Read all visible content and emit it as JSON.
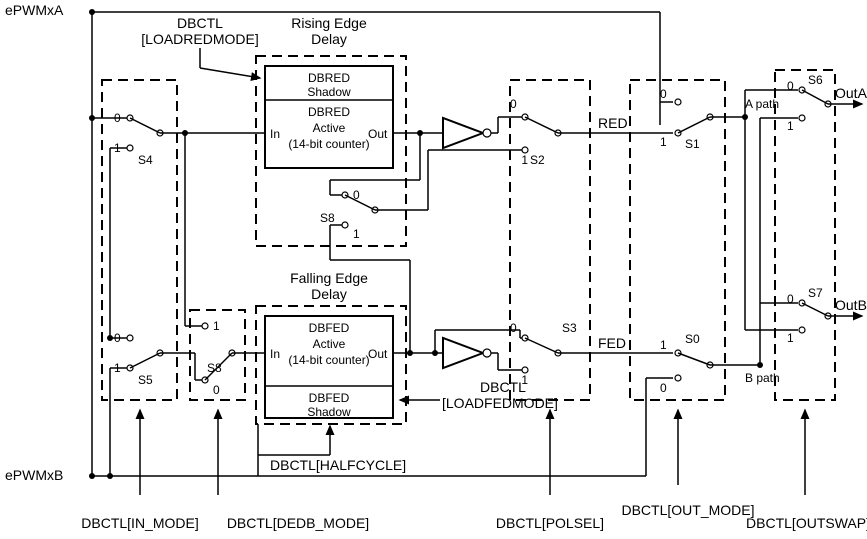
{
  "inputs": {
    "a": "ePWMxA",
    "b": "ePWMxB"
  },
  "outputs": {
    "a": "OutA",
    "b": "OutB"
  },
  "paths": {
    "a": "A path",
    "b": "B path"
  },
  "midSignals": {
    "red": "RED",
    "fed": "FED"
  },
  "switches": {
    "s0": "S0",
    "s1": "S1",
    "s2": "S2",
    "s3": "S3",
    "s4": "S4",
    "s5": "S5",
    "s6": "S6",
    "s7": "S7",
    "s8a": "S8",
    "s8b": "S8"
  },
  "selBits": {
    "zero": "0",
    "one": "1"
  },
  "topLabels": {
    "dbctl_loadred": "DBCTL",
    "loadredmode": "[LOADREDMODE]",
    "rising_edge": "Rising Edge",
    "rising_delay": "Delay",
    "falling_edge": "Falling Edge",
    "falling_delay": "Delay"
  },
  "blocks": {
    "dbred_shadow": "DBRED",
    "dbred_shadow2": "Shadow",
    "dbred_active": "DBRED",
    "dbred_active2": "Active",
    "dbred_counter": "(14-bit counter)",
    "dbfed_active": "DBFED",
    "dbfed_active2": "Active",
    "dbfed_counter": "(14-bit counter)",
    "dbfed_shadow": "DBFED",
    "dbfed_shadow2": "Shadow",
    "in": "In",
    "out": "Out"
  },
  "midCtrl": {
    "dbctl": "DBCTL",
    "loadfedmode": "[LOADFEDMODE]"
  },
  "bottomLabels": {
    "in_mode": "DBCTL[IN_MODE]",
    "dedb_mode": "DBCTL[DEDB_MODE]",
    "halfcycle": "DBCTL[HALFCYCLE]",
    "polsel": "DBCTL[POLSEL]",
    "out_mode": "DBCTL[OUT_MODE]",
    "outswap": "DBCTL[OUTSWAP]"
  }
}
